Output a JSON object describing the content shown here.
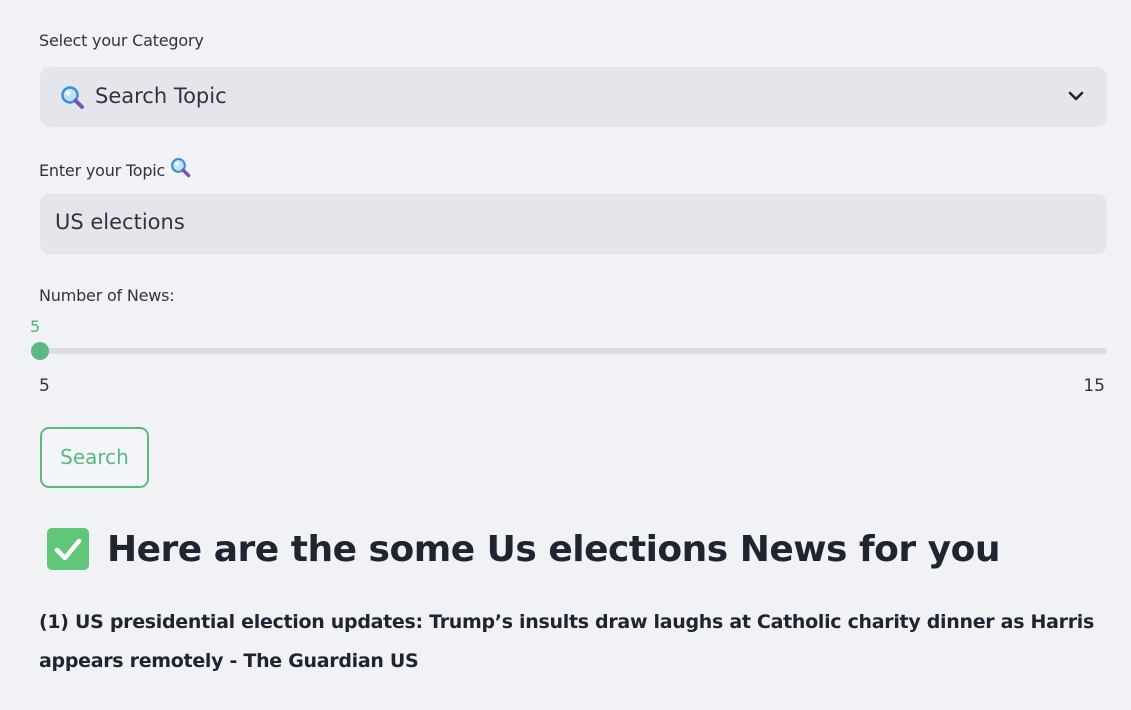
{
  "category": {
    "label": "Select your Category",
    "selected": "Search Topic",
    "icon": "magnifying-glass-icon"
  },
  "topic": {
    "label": "Enter your Topic",
    "value": "US elections",
    "icon": "magnifying-glass-icon"
  },
  "news_count": {
    "label": "Number of News:",
    "current": "5",
    "min": "5",
    "max": "15",
    "fraction": 0
  },
  "search_button": {
    "label": "Search"
  },
  "results": {
    "heading": "Here are the some Us elections News for you",
    "items": [
      "(1) US presidential election updates: Trump’s insults draw laughs at Catholic charity dinner as Harris appears remotely - The Guardian US"
    ]
  },
  "colors": {
    "accent": "#5cb883",
    "check": "#5fc67a",
    "input_bg": "#e4e6ec",
    "page_bg": "#f0f2f6"
  }
}
